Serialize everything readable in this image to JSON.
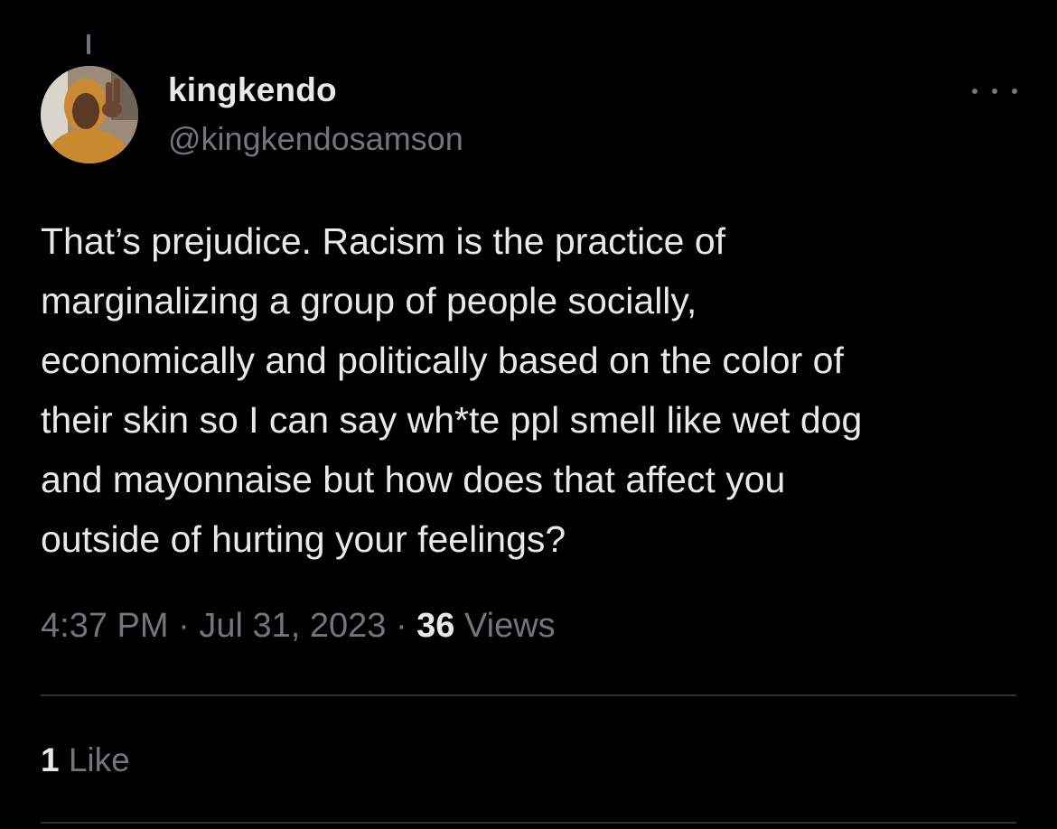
{
  "tweet": {
    "author": {
      "display_name": "kingkendo",
      "handle": "@kingkendosamson"
    },
    "text_lines": [
      "That’s prejudice. Racism is the practice of",
      "marginalizing a group of people socially,",
      "economically and politically based on the color of",
      "their skin so I can say wh*te ppl smell like wet dog",
      "and mayonnaise but how does that affect you",
      "outside of hurting your feelings?"
    ],
    "time": "4:37 PM",
    "separator": "·",
    "date": "Jul 31, 2023",
    "views_count": "36",
    "views_label": "Views",
    "likes_count": "1",
    "likes_label": "Like"
  },
  "icons": {
    "more": "more-horizontal-icon",
    "avatar": "profile-photo"
  },
  "colors": {
    "background": "#000000",
    "primary_text": "#e7e9ea",
    "secondary_text": "#71767b",
    "divider": "#2f3336"
  }
}
